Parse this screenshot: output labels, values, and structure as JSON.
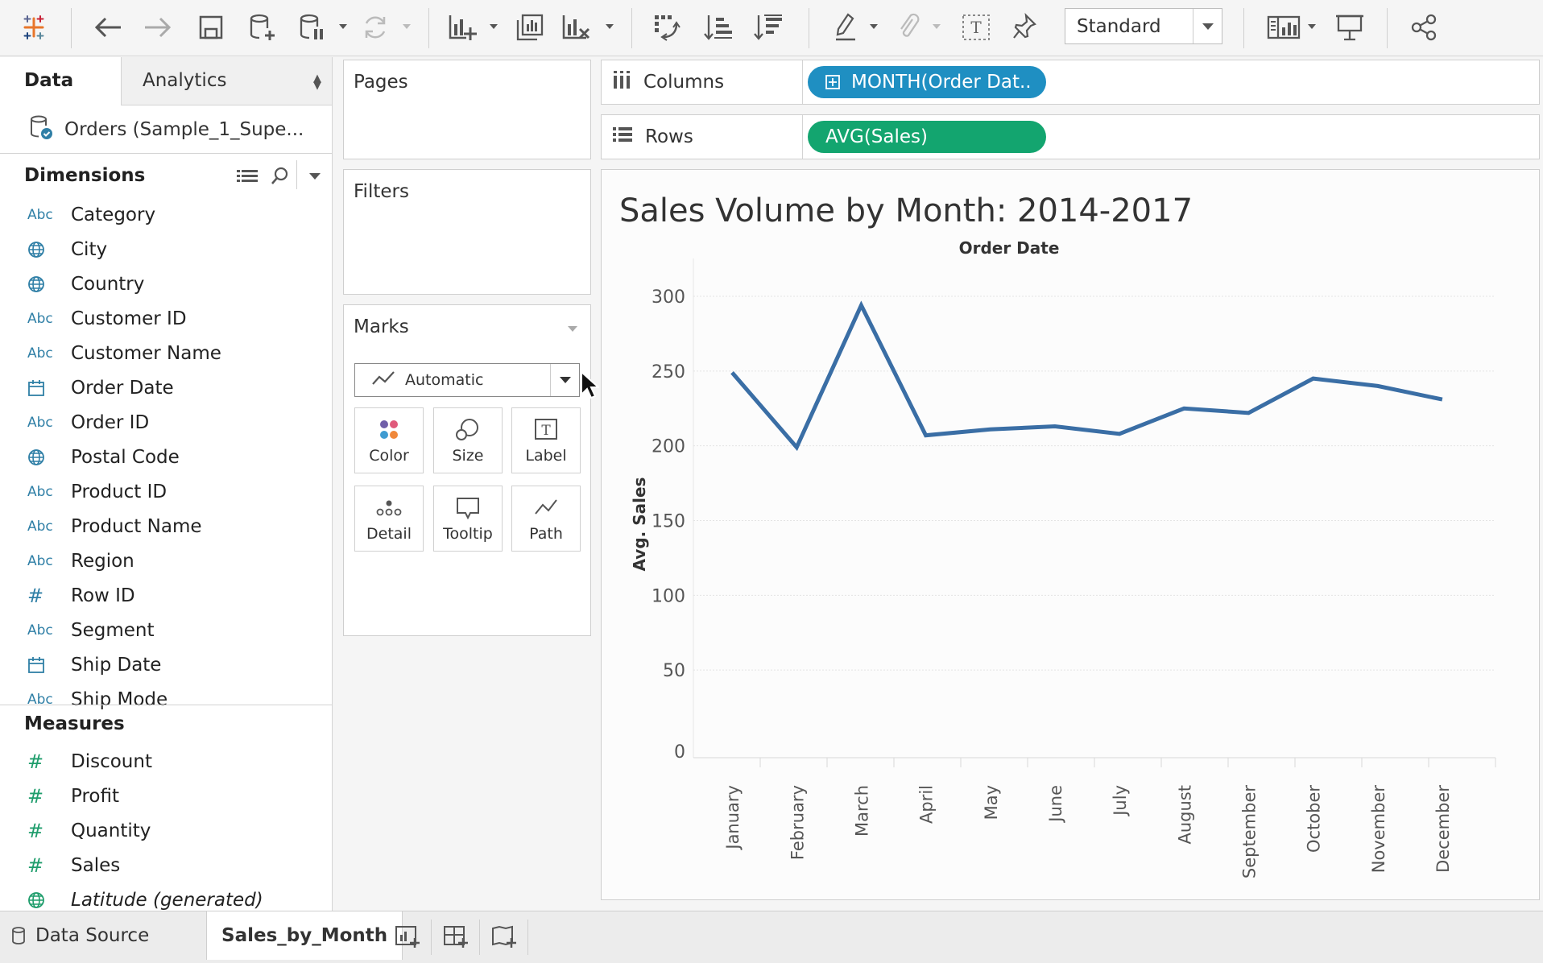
{
  "toolbar": {
    "fit_select": "Standard"
  },
  "data_pane": {
    "tab_data": "Data",
    "tab_analytics": "Analytics",
    "datasource": "Orders (Sample_1_Supe...",
    "dimensions_title": "Dimensions",
    "dimensions": [
      {
        "icon": "Abc",
        "label": "Category"
      },
      {
        "icon": "globe",
        "label": "City"
      },
      {
        "icon": "globe",
        "label": "Country"
      },
      {
        "icon": "Abc",
        "label": "Customer ID"
      },
      {
        "icon": "Abc",
        "label": "Customer Name"
      },
      {
        "icon": "calendar",
        "label": "Order Date"
      },
      {
        "icon": "Abc",
        "label": "Order ID"
      },
      {
        "icon": "globe",
        "label": "Postal Code"
      },
      {
        "icon": "Abc",
        "label": "Product ID"
      },
      {
        "icon": "Abc",
        "label": "Product Name"
      },
      {
        "icon": "Abc",
        "label": "Region"
      },
      {
        "icon": "#",
        "label": "Row ID"
      },
      {
        "icon": "Abc",
        "label": "Segment"
      },
      {
        "icon": "calendar",
        "label": "Ship Date"
      },
      {
        "icon": "Abc",
        "label": "Ship Mode"
      }
    ],
    "measures_title": "Measures",
    "measures": [
      {
        "icon": "#",
        "label": "Discount"
      },
      {
        "icon": "#",
        "label": "Profit"
      },
      {
        "icon": "#",
        "label": "Quantity"
      },
      {
        "icon": "#",
        "label": "Sales"
      },
      {
        "icon": "globe",
        "label": "Latitude (generated)"
      }
    ]
  },
  "cards": {
    "pages": "Pages",
    "filters": "Filters",
    "marks": "Marks",
    "mark_type": "Automatic",
    "mark_buttons": [
      "Color",
      "Size",
      "Label",
      "Detail",
      "Tooltip",
      "Path"
    ]
  },
  "shelves": {
    "columns_label": "Columns",
    "columns_pill": "MONTH(Order Dat..",
    "rows_label": "Rows",
    "rows_pill": "AVG(Sales)"
  },
  "viz": {
    "title": "Sales Volume by Month: 2014-2017"
  },
  "chart_data": {
    "type": "line",
    "title": "Sales Volume by Month: 2014-2017",
    "xlabel": "Order Date",
    "ylabel": "Avg. Sales",
    "categories": [
      "January",
      "February",
      "March",
      "April",
      "May",
      "June",
      "July",
      "August",
      "September",
      "October",
      "November",
      "December"
    ],
    "values": [
      249,
      199,
      294,
      207,
      211,
      213,
      208,
      225,
      222,
      245,
      240,
      231
    ],
    "ylim": [
      0,
      300
    ],
    "yticks": [
      0,
      50,
      100,
      150,
      200,
      250,
      300
    ],
    "line_color": "#3a6ea5",
    "grid": true
  },
  "bottom_tabs": {
    "data_source": "Data Source",
    "sheet": "Sales_by_Month"
  },
  "colors": {
    "columns_pill": "#1f8fc2",
    "rows_pill": "#13a56f"
  }
}
